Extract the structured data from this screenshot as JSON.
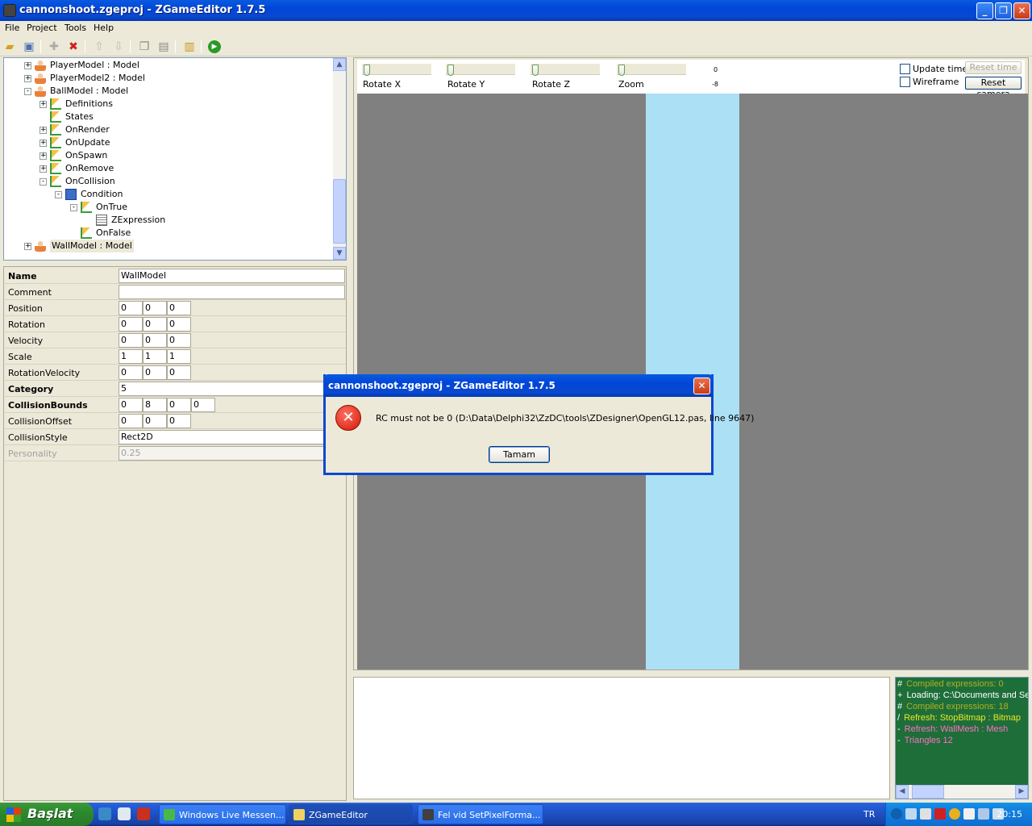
{
  "window": {
    "title": "cannonshoot.zgeproj - ZGameEditor 1.7.5"
  },
  "menu": [
    "File",
    "Project",
    "Tools",
    "Help"
  ],
  "toolbar_icons": [
    "open-icon",
    "save-icon",
    "add-icon",
    "delete-icon",
    "move-up-icon",
    "move-down-icon",
    "copy-icon",
    "paste-icon",
    "lock-icon",
    "run-icon"
  ],
  "tree": {
    "nodes": [
      {
        "label": "PlayerModel : Model",
        "icon": "person-icon",
        "level": 1,
        "expander": "+"
      },
      {
        "label": "PlayerModel2 : Model",
        "icon": "person-icon",
        "level": 1,
        "expander": "+"
      },
      {
        "label": "BallModel : Model",
        "icon": "person-icon",
        "level": 1,
        "expander": "-"
      },
      {
        "label": "Definitions",
        "icon": "component-list-icon",
        "level": 2,
        "expander": "+"
      },
      {
        "label": "States",
        "icon": "component-list-icon",
        "level": 2,
        "expander": ""
      },
      {
        "label": "OnRender",
        "icon": "component-list-icon",
        "level": 2,
        "expander": "+"
      },
      {
        "label": "OnUpdate",
        "icon": "component-list-icon",
        "level": 2,
        "expander": "+"
      },
      {
        "label": "OnSpawn",
        "icon": "component-list-icon",
        "level": 2,
        "expander": "+"
      },
      {
        "label": "OnRemove",
        "icon": "component-list-icon",
        "level": 2,
        "expander": "+"
      },
      {
        "label": "OnCollision",
        "icon": "component-list-icon",
        "level": 2,
        "expander": "-"
      },
      {
        "label": "Condition",
        "icon": "condition-icon",
        "level": 3,
        "expander": "-"
      },
      {
        "label": "OnTrue",
        "icon": "component-list-icon",
        "level": 4,
        "expander": "-"
      },
      {
        "label": "ZExpression",
        "icon": "expression-icon",
        "level": 5,
        "expander": ""
      },
      {
        "label": "OnFalse",
        "icon": "component-list-icon",
        "level": 4,
        "expander": ""
      },
      {
        "label": "WallModel : Model",
        "icon": "person-icon",
        "level": 1,
        "expander": "+",
        "selected": true
      }
    ]
  },
  "properties": [
    {
      "label": "Name",
      "bold": true,
      "values": [
        "WallModel"
      ],
      "wide": true
    },
    {
      "label": "Comment",
      "bold": false,
      "values": [
        ""
      ],
      "wide": true
    },
    {
      "label": "Position",
      "bold": false,
      "values": [
        "0",
        "0",
        "0"
      ]
    },
    {
      "label": "Rotation",
      "bold": false,
      "values": [
        "0",
        "0",
        "0"
      ]
    },
    {
      "label": "Velocity",
      "bold": false,
      "values": [
        "0",
        "0",
        "0"
      ]
    },
    {
      "label": "Scale",
      "bold": false,
      "values": [
        "1",
        "1",
        "1"
      ]
    },
    {
      "label": "RotationVelocity",
      "bold": false,
      "values": [
        "0",
        "0",
        "0"
      ]
    },
    {
      "label": "Category",
      "bold": true,
      "values": [
        "5"
      ],
      "wide": true
    },
    {
      "label": "CollisionBounds",
      "bold": true,
      "values": [
        "0",
        "8",
        "0",
        "0"
      ]
    },
    {
      "label": "CollisionOffset",
      "bold": false,
      "values": [
        "0",
        "0",
        "0"
      ]
    },
    {
      "label": "CollisionStyle",
      "bold": false,
      "values": [
        "Rect2D"
      ],
      "wide": true
    },
    {
      "label": "Personality",
      "bold": false,
      "values": [
        "0.25"
      ],
      "wide": true,
      "disabled": true
    }
  ],
  "preview": {
    "sliders": [
      {
        "label": "Rotate X",
        "level": 0
      },
      {
        "label": "Rotate Y",
        "level": 0
      },
      {
        "label": "Rotate Z",
        "level": 0
      },
      {
        "label": "Zoom",
        "level": 0
      }
    ],
    "small_readout_top": "0",
    "small_readout_bottom": "-8",
    "update_time_label": "Update time",
    "wireframe_label": "Wireframe",
    "reset_time_label": "Reset time",
    "reset_camera_label": "Reset camera",
    "viewport_bg": "#808080",
    "wall_color": "#ace0f4"
  },
  "log": [
    {
      "prefix": "#",
      "text": "Compiled expressions: 0",
      "color": "#b0b020"
    },
    {
      "prefix": "+",
      "text": "Loading: C:\\Documents and Sett",
      "color": "#ffffff"
    },
    {
      "prefix": "#",
      "text": "Compiled expressions: 18",
      "color": "#b0b020"
    },
    {
      "prefix": "/",
      "text": "Refresh: StopBitmap : Bitmap",
      "color": "#e8e820"
    },
    {
      "prefix": "-",
      "text": "Refresh: WallMesh : Mesh",
      "color": "#ff70c0"
    },
    {
      "prefix": "-",
      "text": "Triangles 12",
      "color": "#ff70c0"
    }
  ],
  "dialog": {
    "title": "cannonshoot.zgeproj - ZGameEditor 1.7.5",
    "message": "RC must not be 0 (D:\\Data\\Delphi32\\ZzDC\\tools\\ZDesigner\\OpenGL12.pas, line 9647)",
    "ok_label": "Tamam"
  },
  "taskbar": {
    "start_label": "Başlat",
    "tasks": [
      {
        "label": "Windows Live Messen...",
        "icon": "messenger-icon"
      },
      {
        "label": "ZGameEditor",
        "icon": "folder-icon",
        "active": true
      },
      {
        "label": "Fel vid SetPixelForma...",
        "icon": "zge-icon"
      }
    ],
    "language": "TR",
    "clock": "20:15"
  },
  "colors": {
    "title_blue": "#0a48d0",
    "log_bg": "#1e6e3a"
  }
}
